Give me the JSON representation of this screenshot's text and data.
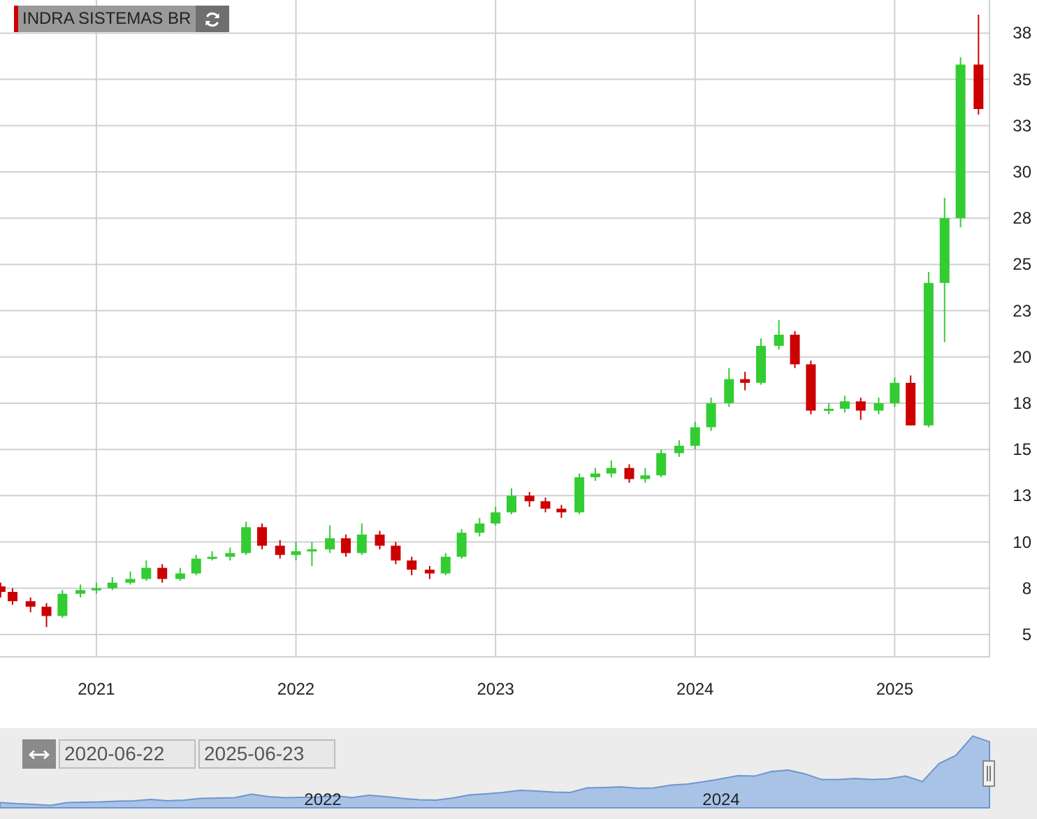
{
  "title_tag": {
    "label": "INDRA SISTEMAS BR"
  },
  "price_chart": {
    "chart_data": {
      "type": "candlestick",
      "grid": true,
      "x": [
        2020.52,
        2020.58,
        2020.67,
        2020.75,
        2020.83,
        2020.92,
        2021,
        2021.08,
        2021.17,
        2021.25,
        2021.33,
        2021.42,
        2021.5,
        2021.58,
        2021.67,
        2021.75,
        2021.83,
        2021.92,
        2022,
        2022.08,
        2022.17,
        2022.25,
        2022.33,
        2022.42,
        2022.5,
        2022.58,
        2022.67,
        2022.75,
        2022.83,
        2022.92,
        2023,
        2023.08,
        2023.17,
        2023.25,
        2023.33,
        2023.42,
        2023.5,
        2023.58,
        2023.67,
        2023.75,
        2023.83,
        2023.92,
        2024,
        2024.08,
        2024.17,
        2024.25,
        2024.33,
        2024.42,
        2024.5,
        2024.58,
        2024.67,
        2024.75,
        2024.83,
        2024.92,
        2025,
        2025.08,
        2025.17,
        2025.25,
        2025.33,
        2025.42
      ],
      "ohlc": [
        [
          7.6,
          7.8,
          7.0,
          7.3
        ],
        [
          7.3,
          7.5,
          6.6,
          6.8
        ],
        [
          6.8,
          7.0,
          6.2,
          6.5
        ],
        [
          6.5,
          6.7,
          5.4,
          6.0
        ],
        [
          6.0,
          7.4,
          5.9,
          7.2
        ],
        [
          7.2,
          7.7,
          7.0,
          7.4
        ],
        [
          7.4,
          7.8,
          7.2,
          7.5
        ],
        [
          7.5,
          8.1,
          7.4,
          7.8
        ],
        [
          7.8,
          8.4,
          7.7,
          8.0
        ],
        [
          8.0,
          9.0,
          7.9,
          8.6
        ],
        [
          8.6,
          8.8,
          7.8,
          8.0
        ],
        [
          8.0,
          8.6,
          7.9,
          8.3
        ],
        [
          8.3,
          9.3,
          8.2,
          9.1
        ],
        [
          9.1,
          9.5,
          9.0,
          9.2
        ],
        [
          9.2,
          9.7,
          9.0,
          9.4
        ],
        [
          9.4,
          11.1,
          9.3,
          10.8
        ],
        [
          10.8,
          11.0,
          9.6,
          9.8
        ],
        [
          9.8,
          10.1,
          9.1,
          9.3
        ],
        [
          9.3,
          10.0,
          9.0,
          9.5
        ],
        [
          9.5,
          10.0,
          8.7,
          9.6
        ],
        [
          9.6,
          10.9,
          9.4,
          10.2
        ],
        [
          10.2,
          10.4,
          9.2,
          9.4
        ],
        [
          9.4,
          11.0,
          9.3,
          10.4
        ],
        [
          10.4,
          10.6,
          9.6,
          9.8
        ],
        [
          9.8,
          10.0,
          8.8,
          9.0
        ],
        [
          9.0,
          9.2,
          8.2,
          8.5
        ],
        [
          8.5,
          8.7,
          8.0,
          8.3
        ],
        [
          8.3,
          9.4,
          8.2,
          9.2
        ],
        [
          9.2,
          10.7,
          9.1,
          10.5
        ],
        [
          10.5,
          11.3,
          10.3,
          11.0
        ],
        [
          11.0,
          11.9,
          10.9,
          11.6
        ],
        [
          11.6,
          12.9,
          11.5,
          12.5
        ],
        [
          12.5,
          12.7,
          11.9,
          12.2
        ],
        [
          12.2,
          12.4,
          11.6,
          11.8
        ],
        [
          11.8,
          12.0,
          11.3,
          11.6
        ],
        [
          11.6,
          13.7,
          11.5,
          13.5
        ],
        [
          13.5,
          14.0,
          13.3,
          13.7
        ],
        [
          13.7,
          14.4,
          13.5,
          14.0
        ],
        [
          14.0,
          14.2,
          13.2,
          13.4
        ],
        [
          13.4,
          14.0,
          13.2,
          13.6
        ],
        [
          13.6,
          15.0,
          13.5,
          14.8
        ],
        [
          14.8,
          15.5,
          14.6,
          15.2
        ],
        [
          15.2,
          16.5,
          15.0,
          16.2
        ],
        [
          16.2,
          17.8,
          16.0,
          17.5
        ],
        [
          17.5,
          19.4,
          17.3,
          18.8
        ],
        [
          18.8,
          19.2,
          18.2,
          18.6
        ],
        [
          18.6,
          21.0,
          18.5,
          20.6
        ],
        [
          20.6,
          22.0,
          20.4,
          21.2
        ],
        [
          21.2,
          21.4,
          19.4,
          19.6
        ],
        [
          19.6,
          19.8,
          16.9,
          17.1
        ],
        [
          17.1,
          17.5,
          16.9,
          17.2
        ],
        [
          17.2,
          17.9,
          17.0,
          17.6
        ],
        [
          17.6,
          17.8,
          16.6,
          17.1
        ],
        [
          17.1,
          17.8,
          16.9,
          17.5
        ],
        [
          17.5,
          18.9,
          17.3,
          18.6
        ],
        [
          18.6,
          19.0,
          16.3,
          16.3
        ],
        [
          16.3,
          24.6,
          16.2,
          24.0
        ],
        [
          24.0,
          28.6,
          20.8,
          27.5
        ],
        [
          27.5,
          36.2,
          27.0,
          35.8
        ],
        [
          35.8,
          38.5,
          33.1,
          33.4
        ]
      ],
      "xticks": [
        {
          "value": 2021,
          "label": "2021"
        },
        {
          "value": 2022,
          "label": "2022"
        },
        {
          "value": 2023,
          "label": "2023"
        },
        {
          "value": 2024,
          "label": "2024"
        },
        {
          "value": 2025,
          "label": "2025"
        }
      ],
      "yticks": [
        {
          "value": 37.5,
          "label": "38"
        },
        {
          "value": 35,
          "label": "35"
        },
        {
          "value": 32.5,
          "label": "33"
        },
        {
          "value": 30,
          "label": "30"
        },
        {
          "value": 27.5,
          "label": "28"
        },
        {
          "value": 25,
          "label": "25"
        },
        {
          "value": 22.5,
          "label": "23"
        },
        {
          "value": 20,
          "label": "20"
        },
        {
          "value": 17.5,
          "label": "18"
        },
        {
          "value": 15,
          "label": "15"
        },
        {
          "value": 12.5,
          "label": "13"
        },
        {
          "value": 10,
          "label": "10"
        },
        {
          "value": 7.5,
          "label": "8"
        },
        {
          "value": 5,
          "label": "5"
        }
      ],
      "xlim": [
        2020.517,
        2025.475
      ],
      "ylim": [
        3.79,
        39.29
      ]
    }
  },
  "navigator": {
    "from_date": "2020-06-22",
    "to_date": "2025-06-23",
    "labels": [
      "2022",
      "2024"
    ]
  }
}
